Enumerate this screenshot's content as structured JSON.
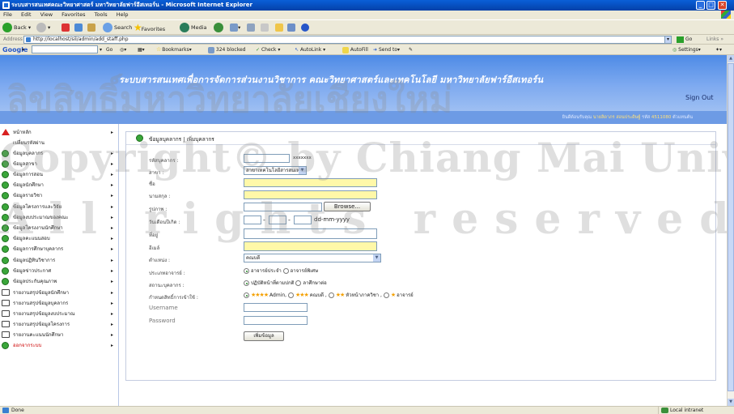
{
  "window": {
    "title": "ระบบสารสนเทศคณะวิทยาศาสตร์ มหาวิทยาลัยฟาร์อีสเทอร์น - Microsoft Internet Explorer",
    "min_label": "_",
    "max_label": "□",
    "close_label": "✕"
  },
  "menubar": [
    "File",
    "Edit",
    "View",
    "Favorites",
    "Tools",
    "Help"
  ],
  "toolbar": {
    "back": "Back",
    "search": "Search",
    "favorites": "Favorites",
    "media": "Media"
  },
  "address": {
    "label": "Address",
    "url": "http://localhost/sil/admin/add_staff.php",
    "go": "Go",
    "links": "Links »"
  },
  "googlebar": {
    "logo": "Google",
    "go": "Go",
    "bookmarks": "Bookmarks▾",
    "blocked": "324 blocked",
    "check": "Check ▾",
    "autolink": "AutoLink ▾",
    "autofill": "AutoFill",
    "sendto": "Send to▾",
    "settings": "Settings▾"
  },
  "site": {
    "title": "ระบบสารสนเทศเพื่อการจัดการส่วนงานวิชาการ คณะวิทยาศาสตร์และเทคโนโลยี มหาวิทยาลัยฟาร์อีสเทอร์น",
    "signout": "Sign Out",
    "welcome_prefix": "ยินดีต้อนรับคุณ",
    "welcome_name": "นายลิดาภร สอนประดิษฐ์",
    "welcome_id_label": "รหัส",
    "welcome_id": "4511080",
    "welcome_suffix": "ตัวแทนต้น"
  },
  "sidebar": [
    {
      "label": "หน้าหลัก",
      "icon": "home-icon",
      "arrow": "▸"
    },
    {
      "label": "เปลี่ยนรหัสผ่าน",
      "icon": "none",
      "arrow": ""
    },
    {
      "label": "ข้อมูลบุคลากร",
      "icon": "green-bullet-icon",
      "arrow": "▸"
    },
    {
      "label": "ข้อมูลสาขา",
      "icon": "green-bullet-icon",
      "arrow": "▸"
    },
    {
      "label": "ข้อมูลการสอน",
      "icon": "green-bullet-icon",
      "arrow": "▸"
    },
    {
      "label": "ข้อมูลนักศึกษา",
      "icon": "green-bullet-icon",
      "arrow": "▸"
    },
    {
      "label": "ข้อมูลรายวิชา",
      "icon": "green-bullet-icon",
      "arrow": "▸"
    },
    {
      "label": "ข้อมูลโครงการและวิจัย",
      "icon": "green-bullet-icon",
      "arrow": "▸"
    },
    {
      "label": "ข้อมูลงบประมาณของคณะ",
      "icon": "green-bullet-icon",
      "arrow": "▸"
    },
    {
      "label": "ข้อมูลโครงงานนักศึกษา",
      "icon": "green-bullet-icon",
      "arrow": "▸"
    },
    {
      "label": "ข้อมูลคะแนนสอบ",
      "icon": "green-bullet-icon",
      "arrow": "▸"
    },
    {
      "label": "ข้อมูลการศึกษาบุคลากร",
      "icon": "green-bullet-icon",
      "arrow": "▸"
    },
    {
      "label": "ข้อมูลปฏิทินวิชาการ",
      "icon": "green-bullet-icon",
      "arrow": "▸"
    },
    {
      "label": "ข้อมูลข่าวประกาศ",
      "icon": "green-bullet-icon",
      "arrow": "▸"
    },
    {
      "label": "ข้อมูลประกันคุณภาพ",
      "icon": "green-bullet-icon",
      "arrow": "▸"
    },
    {
      "label": "รายงานสรุปข้อมูลนักศึกษา",
      "icon": "book-icon",
      "arrow": "▸"
    },
    {
      "label": "รายงานสรุปข้อมูลบุคลากร",
      "icon": "book-icon",
      "arrow": "▸"
    },
    {
      "label": "รายงานสรุปข้อมูลงบประมาณ",
      "icon": "book-icon",
      "arrow": "▸"
    },
    {
      "label": "รายงานสรุปข้อมูลโครงการ",
      "icon": "book-icon",
      "arrow": "▸"
    },
    {
      "label": "รายงานคะแนนนักศึกษา",
      "icon": "book-icon",
      "arrow": "▸"
    },
    {
      "label": "ออกจากระบบ",
      "icon": "green-bullet-icon",
      "arrow": "▸"
    }
  ],
  "panel": {
    "title": "ข้อมูลบุคลากร | เพิ่มบุคลากร",
    "fields": {
      "staff_id": {
        "label": "รหัสบุคลากร :",
        "hint": "xxxxxxx"
      },
      "branch": {
        "label": "สาขา :",
        "value": "สาขาเทคโนโลยีสารสนเทศ"
      },
      "name": {
        "label": "ชื่อ"
      },
      "surname": {
        "label": "นามสกุล :"
      },
      "photo": {
        "label": "รูปภาพ :",
        "browse": "Browse..."
      },
      "birthdate": {
        "label": "วันเดือนปีเกิด :",
        "sep": "-",
        "format": "dd-mm-yyyy"
      },
      "address": {
        "label": "ที่อยู่"
      },
      "email": {
        "label": "อีเมล์"
      },
      "position": {
        "label": "ตำแหน่ง :",
        "value": "คณบดี"
      },
      "teacher_type": {
        "label": "ประเภทอาจารย์ :",
        "opt1": "อาจารย์ประจำ",
        "opt2": "อาจารย์พิเศษ"
      },
      "status": {
        "label": "สถานะบุคลากร :",
        "opt1": "ปฏิบัติหน้าที่ตามปกติ",
        "opt2": "ลาศึกษาต่อ"
      },
      "access": {
        "label": "กำหนดสิทธิ์การเข้าใช้ :",
        "opt1_stars": "★★★★",
        "opt1": "Admin,",
        "opt2_stars": "★★★",
        "opt2": "คณบดี ,",
        "opt3_stars": "★★",
        "opt3": "หัวหน้าภาควิชา ,",
        "opt4_stars": "★",
        "opt4": "อาจารย์"
      },
      "username": {
        "label": "Username"
      },
      "password": {
        "label": "Password"
      },
      "submit": "เพิ่มข้อมูล"
    }
  },
  "status": {
    "text": "Done",
    "zone": "Local intranet"
  },
  "watermark": {
    "line1": "ลิขสิทธิ์มหาวิทยาลัยเชียงใหม่",
    "line2": "Copyright© by Chiang Mai University",
    "line3": "All rights reserved"
  },
  "colors": {
    "header": "#5a8fe6",
    "required_field": "#fff8a8",
    "accent_green": "#3aa63a"
  }
}
